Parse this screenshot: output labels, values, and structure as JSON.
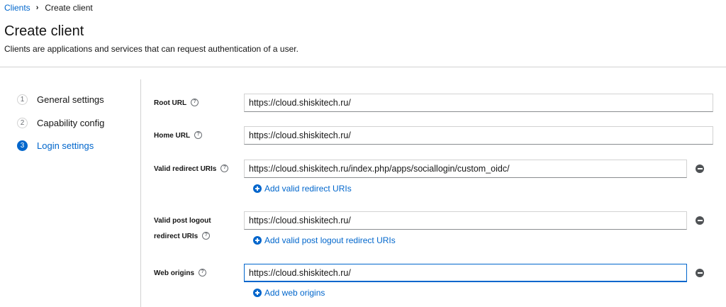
{
  "breadcrumb": {
    "parent": "Clients",
    "current": "Create client"
  },
  "header": {
    "title": "Create client",
    "subtitle": "Clients are applications and services that can request authentication of a user."
  },
  "wizard": {
    "steps": [
      {
        "number": "1",
        "label": "General settings",
        "active": false
      },
      {
        "number": "2",
        "label": "Capability config",
        "active": false
      },
      {
        "number": "3",
        "label": "Login settings",
        "active": true
      }
    ]
  },
  "form": {
    "root_url": {
      "label": "Root URL",
      "value": "https://cloud.shiskitech.ru/"
    },
    "home_url": {
      "label": "Home URL",
      "value": "https://cloud.shiskitech.ru/"
    },
    "valid_redirect": {
      "label": "Valid redirect URIs",
      "value": "https://cloud.shiskitech.ru/index.php/apps/sociallogin/custom_oidc/",
      "add_label": "Add valid redirect URIs"
    },
    "post_logout": {
      "label_line1": "Valid post logout",
      "label_line2": "redirect URIs",
      "value": "https://cloud.shiskitech.ru/",
      "add_label": "Add valid post logout redirect URIs"
    },
    "web_origins": {
      "label": "Web origins",
      "value": "https://cloud.shiskitech.ru/",
      "add_label": "Add web origins"
    }
  },
  "icons": {
    "help": "question-circle-icon",
    "remove": "minus-circle-icon",
    "add": "plus-circle-icon",
    "separator": "chevron-right-icon"
  },
  "colors": {
    "accent": "#0066cc",
    "text": "#151515",
    "border": "#d2d2d2"
  }
}
